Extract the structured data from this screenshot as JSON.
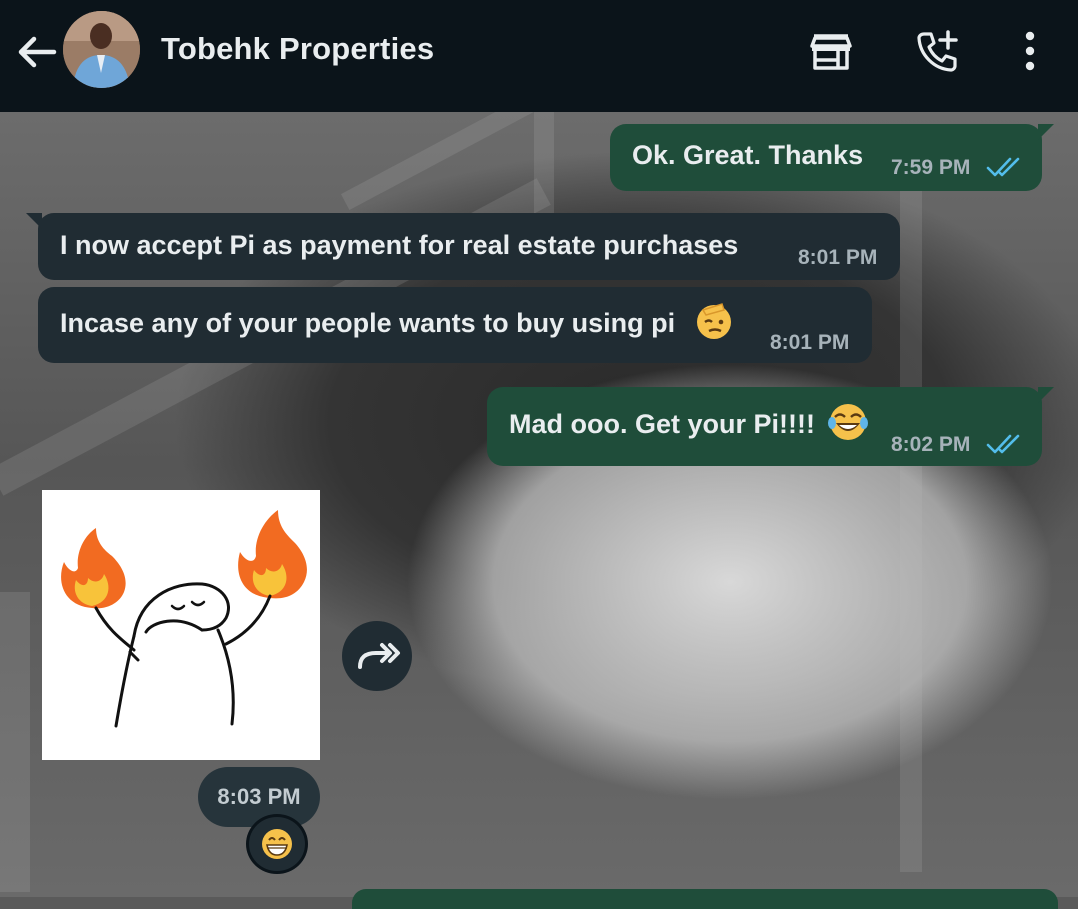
{
  "header": {
    "contact_name": "Tobehk Properties",
    "back_icon": "arrow-left-icon",
    "shop_icon": "storefront-icon",
    "call_icon": "add-call-icon",
    "menu_icon": "more-vertical-icon"
  },
  "messages": [
    {
      "direction": "outgoing",
      "text": "Ok. Great. Thanks",
      "time": "7:59 PM",
      "status": "read"
    },
    {
      "direction": "incoming",
      "text": "I now accept Pi as payment for real estate purchases",
      "time": "8:01 PM"
    },
    {
      "direction": "incoming",
      "text": "Incase any of your people wants to buy using pi",
      "emoji": "🫡",
      "time": "8:01 PM"
    },
    {
      "direction": "outgoing",
      "text": "Mad ooo. Get your Pi!!!!",
      "emoji": "😂",
      "time": "8:02 PM",
      "status": "read"
    }
  ],
  "sticker": {
    "description_icon": "flame-hands-sticker",
    "time": "8:03 PM",
    "forward_icon": "forward-icon",
    "reaction": "😁"
  },
  "colors": {
    "header_bg": "#0b141a",
    "outgoing_bubble": "#1f4d3a",
    "incoming_bubble": "#202c33",
    "read_ticks": "#53bdeb",
    "meta_text": "#a7b3ba"
  }
}
